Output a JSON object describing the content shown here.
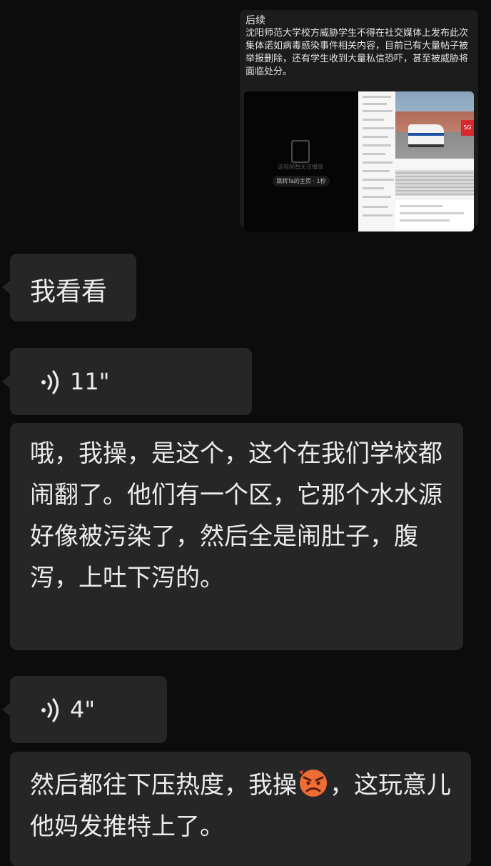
{
  "outgoing_card": {
    "title": "后续",
    "body": "沈阳师范大学校方威胁学生不得在社交媒体上发布此次集体诺如病毒感染事件相关内容，目前已有大量帖子被举报删除，还有学生收到大量私信恐吓，甚至被威胁将面临处分。",
    "video_message": "该视频暂无法播放",
    "video_link": "跳转Ta的主页 · 1秒"
  },
  "messages": [
    {
      "type": "text",
      "text": "我看看"
    },
    {
      "type": "voice",
      "duration": "11\""
    },
    {
      "type": "text",
      "text": "哦，我操，是这个，这个在我们学校都闹翻了。他们有一个区，它那个水水源好像被污染了，然后全是闹肚子，腹泻，上吐下泻的。"
    },
    {
      "type": "voice",
      "duration": "4\""
    },
    {
      "type": "text",
      "text_before_emoji": "然后都往下压热度，我操",
      "emoji": "angry-face-emoji",
      "text_after_emoji": "，这玩意儿他妈发推特上了。"
    }
  ],
  "colors": {
    "background": "#0c0c0c",
    "bubble": "#262626",
    "text": "#ececec"
  }
}
